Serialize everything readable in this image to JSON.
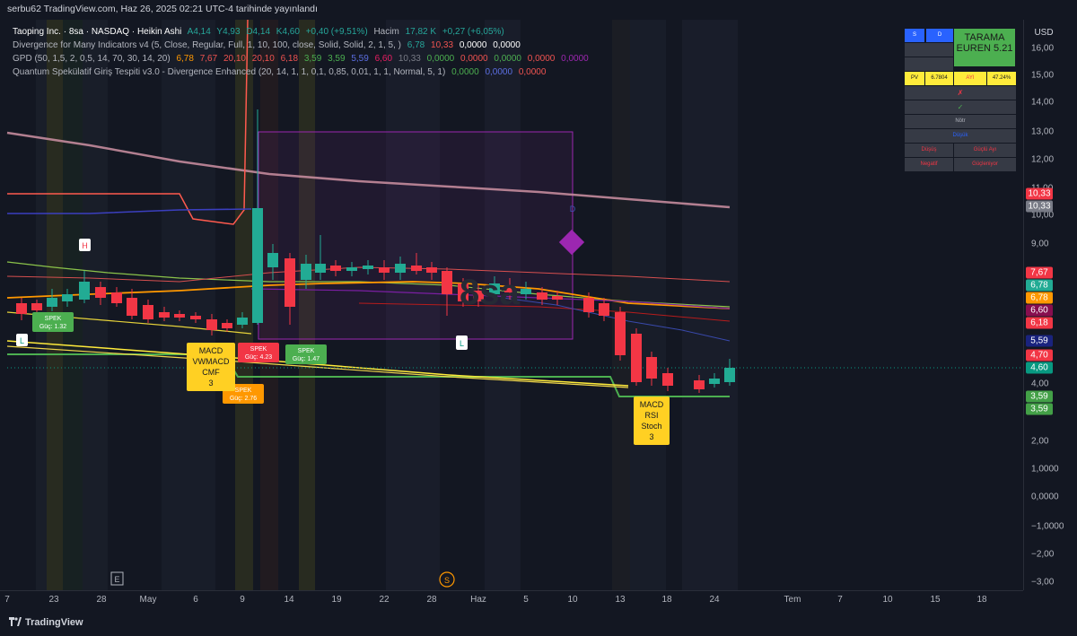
{
  "header": {
    "published_by": "serbu62 TradingView.com, Haz 26, 2025 02:21 UTC-4 tarihinde yayınlandı"
  },
  "legend": {
    "symbol_line": {
      "title": "Taoping Inc. · 8sa · NASDAQ · Heikin Ashi",
      "open": "A4,14",
      "high": "Y4,93",
      "low": "D4,14",
      "close": "K4,60",
      "change": "+0,40 (+9,51%)",
      "volume_label": "Hacim",
      "volume": "17,82 K",
      "volume_change": "+0,27 (+6,05%)"
    },
    "indicator1": {
      "name": "Divergence for Many Indicators v4 (5, Close, Regular, Full, 1, 10, 100, close, Solid, Solid, 2, 1, 5, )",
      "v1": "6,78",
      "v2": "10,33",
      "v3": "0,0000",
      "v4": "0,0000"
    },
    "indicator2": {
      "name": "GPD (50, 1,5, 2, 0,5, 14, 70, 30, 14, 20)",
      "values": [
        "6,78",
        "7,67",
        "20,10",
        "20,10",
        "6,18",
        "3,59",
        "3,59",
        "5,59",
        "6,60",
        "10,33",
        "0,0000",
        "0,0000",
        "0,0000",
        "0,0000",
        "0,0000"
      ]
    },
    "indicator3": {
      "name": "Quantum Spekülatif Giriş Tespiti v3.0 - Divergence Enhanced (20, 14, 1, 1, 0,1, 0,85, 0,01, 1, 1, Normal, 5, 1)",
      "v1": "0,0000",
      "v2": "0,0000",
      "v3": "0,0000"
    }
  },
  "price_axis": {
    "currency": "USD",
    "ticks": [
      "16,00",
      "15,00",
      "14,00",
      "13,00",
      "12,00",
      "11,00",
      "10,00",
      "9,00",
      "4,00",
      "2,00",
      "1,0000",
      "0,0000",
      "−1,0000",
      "−2,00",
      "−3,00"
    ],
    "badges": [
      {
        "label": "10,33",
        "color": "#f23645"
      },
      {
        "label": "10,33",
        "color": "#787b86"
      },
      {
        "label": "7,67",
        "color": "#f23645"
      },
      {
        "label": "6,78",
        "color": "#22ab94"
      },
      {
        "label": "6,78",
        "color": "#ff9800"
      },
      {
        "label": "6,60",
        "color": "#880e4f"
      },
      {
        "label": "6,18",
        "color": "#f23645"
      },
      {
        "label": "5,59",
        "color": "#1a237e"
      },
      {
        "label": "4,70",
        "color": "#f23645"
      },
      {
        "label": "4,60",
        "color": "#089981"
      },
      {
        "label": "3,59",
        "color": "#43a047"
      },
      {
        "label": "3,59",
        "color": "#43a047"
      }
    ]
  },
  "time_axis": {
    "ticks": [
      "7",
      "23",
      "28",
      "May",
      "6",
      "9",
      "14",
      "19",
      "22",
      "28",
      "Haz",
      "5",
      "10",
      "13",
      "18",
      "24",
      "Tem",
      "7",
      "10",
      "15",
      "18"
    ]
  },
  "table": {
    "header": [
      "S",
      "D"
    ],
    "tarama": "TARAMA EUREN 5.21",
    "pv_row": [
      "PV",
      "6.7804",
      "AYI",
      "47.24%"
    ],
    "rows": [
      "✗",
      "✓",
      "Nötr",
      "Düşük"
    ],
    "row5": [
      "Düşüş",
      "Güçlü Ayı"
    ],
    "row6": [
      "Negatif",
      "Güçleniyor"
    ]
  },
  "signals": {
    "h": "H",
    "l1": "L",
    "l2": "L",
    "d": "D",
    "spek1": "SPEK Güç: 1.32",
    "spek2": "SPEK Güç: 4.23",
    "spek3": "SPEK Güç: 1.47",
    "spek4": "SPEK Güç: 2.76",
    "div1": "MACD VWMACD CMF 3",
    "div2": "MACD RSI Stoch 3",
    "e_marker": "E",
    "s_marker": "S",
    "watermark": "8sa"
  },
  "footer": {
    "brand": "TradingView"
  }
}
